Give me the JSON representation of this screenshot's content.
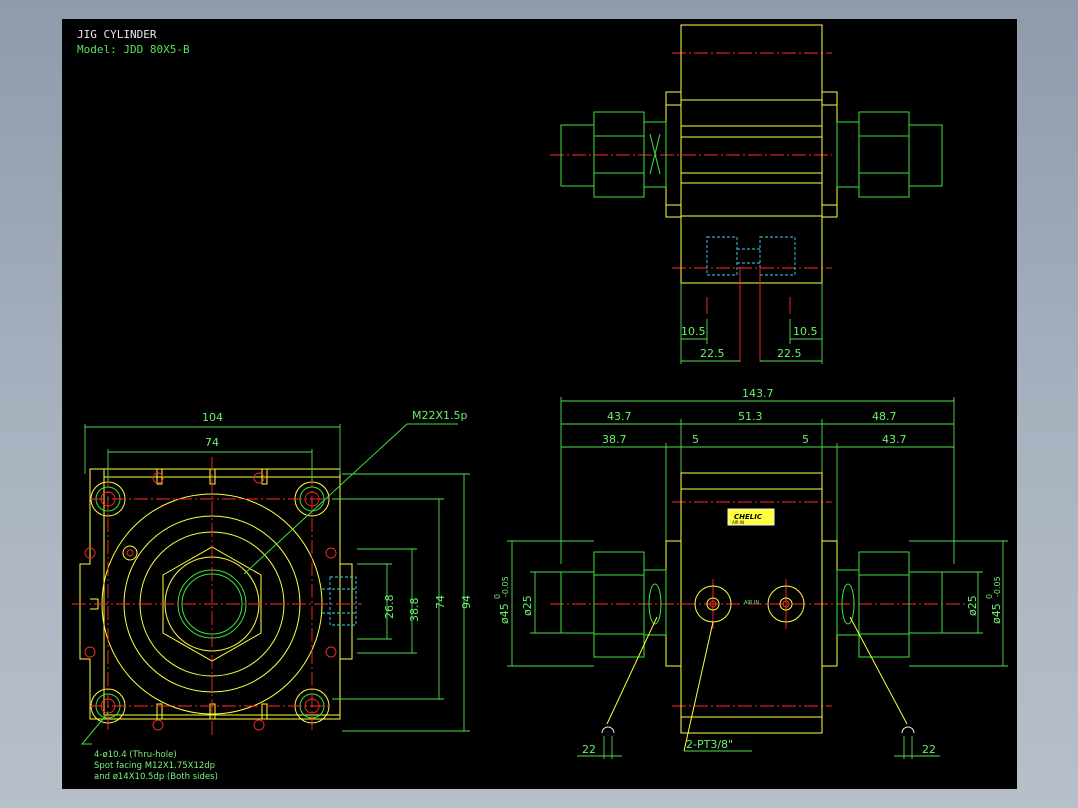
{
  "title_block": {
    "title": "JIG CYLINDER",
    "model": "Model: JDD 80X5-B"
  },
  "top_view": {
    "dims": [
      "10.5",
      "10.5",
      "22.5",
      "22.5"
    ]
  },
  "front_view": {
    "dims_top": [
      "143.7",
      "43.7",
      "51.3",
      "48.7",
      "38.7",
      "5",
      "5",
      "43.7"
    ],
    "dim_left_dia": "ø25",
    "dim_left_outer": "ø45",
    "dim_left_tol_upper": "0",
    "dim_left_tol_lower": "-0.05",
    "dim_right_dia": "ø25",
    "dim_right_outer": "ø45",
    "dim_right_tol_upper": "0",
    "dim_right_tol_lower": "-0.05",
    "dim_bottom_left": "22",
    "dim_bottom_right": "22",
    "port_note": "2-PT3/8\"",
    "label_brand": "CHELIC",
    "label_small": "AIR IN"
  },
  "side_view": {
    "dim_width_outer": "104",
    "dim_width_inner": "74",
    "dim_height_outer": "94",
    "dim_height_inner": "74",
    "dim_port_a": "26.8",
    "dim_port_b": "38.8",
    "thread_note": "M22X1.5p",
    "hole_note_1": "4-ø10.4 (Thru-hole)",
    "hole_note_2": "Spot facing   M12X1.75X12dp",
    "hole_note_3": "and ø14X10.5dp (Both sides)"
  }
}
